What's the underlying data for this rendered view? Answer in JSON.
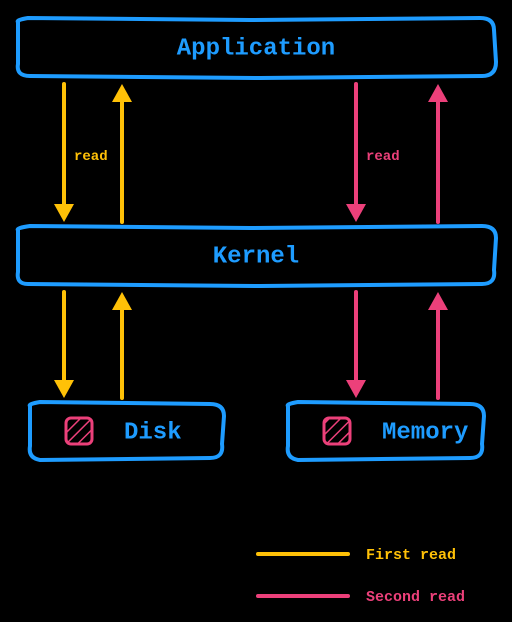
{
  "nodes": {
    "application": "Application",
    "kernel": "Kernel",
    "disk": "Disk",
    "memory": "Memory"
  },
  "edges": {
    "read1": "read",
    "read2": "read"
  },
  "legend": {
    "first": "First read",
    "second": "Second read"
  },
  "colors": {
    "box": "#1e9cff",
    "first": "#ffc107",
    "second": "#ec407a"
  }
}
